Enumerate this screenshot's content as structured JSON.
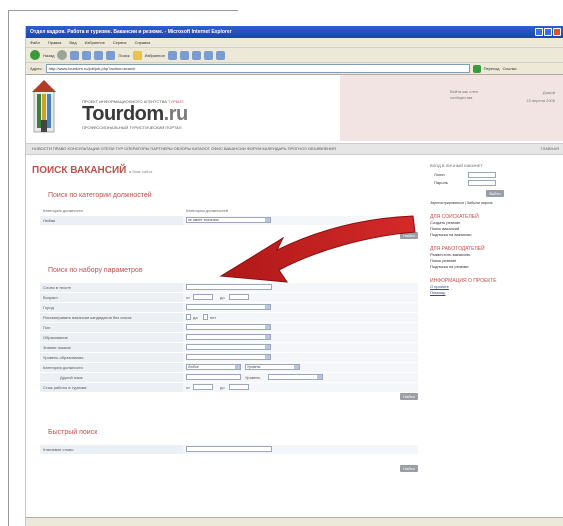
{
  "window": {
    "title": "Отдел кадров. Работа в туризме. Вакансии и резюме. - Microsoft Internet Explorer"
  },
  "menubar": [
    "Файл",
    "Правка",
    "Вид",
    "Избранное",
    "Сервис",
    "Справка"
  ],
  "toolbar": {
    "back_label": "Назад",
    "search_label": "Поиск",
    "favorites_label": "Избранное"
  },
  "address": {
    "label": "Адрес:",
    "url": "http://www.tourdom.ru/job/job.php?action=search",
    "go_label": "Переход",
    "links_label": "Ссылки"
  },
  "header": {
    "tagline": "ПРОЕКТ ИНФОРМАЦИОННОГО АГЕНТСТВА",
    "tagline_brand": "ТУРБИЗ",
    "logo_main": "Tourdom",
    "logo_suffix": ".ru",
    "logo_sub": "ПРОФЕССИОНАЛЬНЫЙ ТУРИСТИЧЕСКИЙ ПОРТАЛ",
    "login_line1": "Войти как член",
    "login_line2": "сообщества",
    "home_label": "Домой",
    "date": "15 апреля 2006"
  },
  "navbar": {
    "items": "НОВОСТИ ПРАВО КОНСУЛЬТАЦИИ ОТЕЛИ ТУР ОПЕРАТОРЫ ПАРТНЕРЫ ОБЗОРЫ КАТАЛОГ ОФИС ВАКАНСИИ ФОРУМ КАЛЕНДАРЬ ПРОГНОЗ ОБЪЯВЛЕНИЯ",
    "right": "ГЛАВНАЯ"
  },
  "page": {
    "title": "ПОИСК ВАКАНСИЙ",
    "subtitle": "в базе сайта"
  },
  "category_search": {
    "title": "Поиск по категории должностей",
    "col1_header": "Категория должности",
    "col2_header": "Категория должностей",
    "col1_value": "Любая",
    "col2_value": "не имеет значения",
    "button": "Найти"
  },
  "param_search": {
    "title": "Поиск по набору параметров",
    "rows": [
      "Слово в тексте",
      "Возраст",
      "Город",
      "Рассматривать вакансии кандидатов без опыта",
      "Пол",
      "Образование",
      "Знание языков",
      "Уровень образования",
      "Категория должности",
      "Другой язык",
      "Стаж работы в туризме"
    ],
    "from_label": "от",
    "to_label": "до",
    "yes_label": "да",
    "no_label": "нет",
    "any_value": "Любое",
    "level_value": "Уровень",
    "level2_label": "Уровень",
    "button": "Найти"
  },
  "quick_search": {
    "title": "Быстрый поиск",
    "row_label": "Ключевое слово",
    "button": "Найти"
  },
  "sidebar": {
    "login_title": "ВХОД В ЛИЧНЫЙ КАБИНЕТ",
    "login_field": "Логин",
    "password_field": "Пароль",
    "login_button": "Войти",
    "register_link": "Зарегистрироваться | Забыли пароль",
    "candidates_title": "ДЛЯ СОИСКАТЕЛЕЙ",
    "candidates_links": [
      "Создать резюме",
      "Поиск вакансий",
      "Подписка на вакансии"
    ],
    "employers_title": "ДЛЯ РАБОТОДАТЕЛЕЙ",
    "employers_links": [
      "Разместить вакансию",
      "Поиск резюме",
      "Подписка на резюме"
    ],
    "info_title": "ИНФОРМАЦИЯ О ПРОЕКТЕ",
    "info_links": [
      "О проекте",
      "Помощь"
    ]
  },
  "colors": {
    "accent_red": "#c0504d",
    "titlebar_blue": "#2c5fcf",
    "header_pink": "#f3e4e4"
  }
}
